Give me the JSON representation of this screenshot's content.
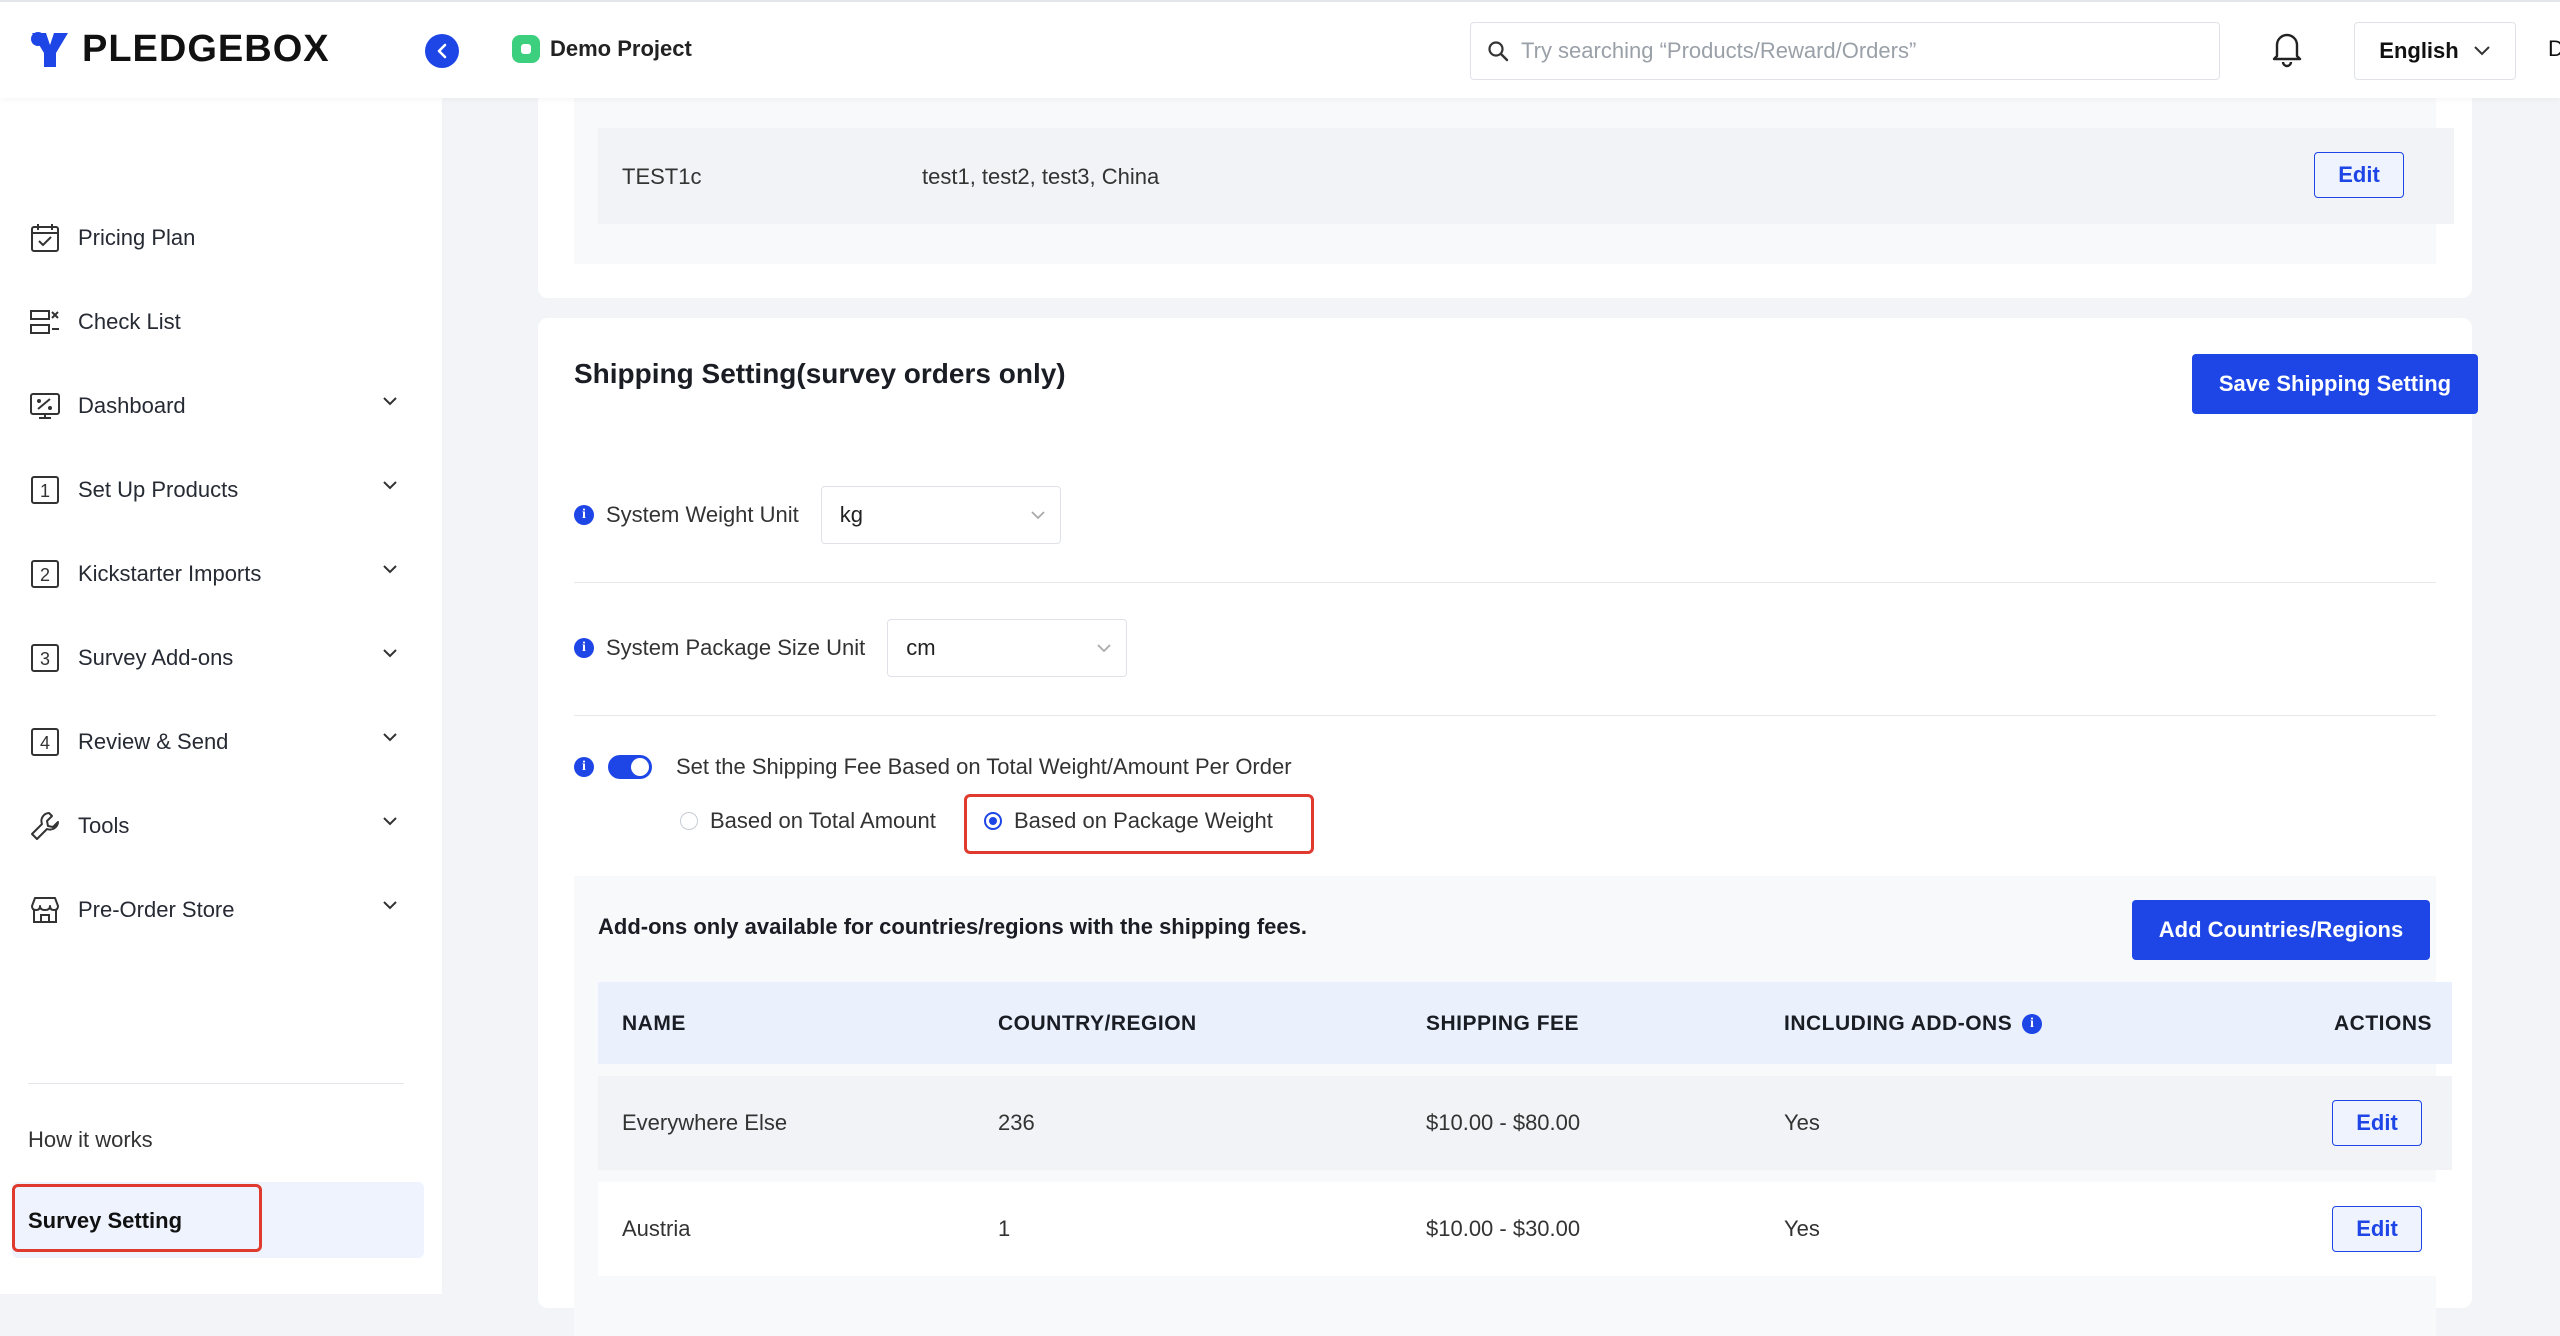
{
  "app": {
    "logo_text": "PLEDGEBOX",
    "project_name": "Demo Project"
  },
  "search": {
    "placeholder": "Try searching “Products/Reward/Orders”"
  },
  "language": {
    "selected": "English"
  },
  "edge_char": "D",
  "sidebar": {
    "items": [
      {
        "label": "Pricing Plan",
        "icon": "calendar-check-icon"
      },
      {
        "label": "Check List",
        "icon": "checklist-icon"
      },
      {
        "label": "Dashboard",
        "icon": "dashboard-icon"
      },
      {
        "label": "Set Up Products",
        "icon": "step-1-icon",
        "step": "1"
      },
      {
        "label": "Kickstarter Imports",
        "icon": "step-2-icon",
        "step": "2"
      },
      {
        "label": "Survey Add-ons",
        "icon": "step-3-icon",
        "step": "3"
      },
      {
        "label": "Review & Send",
        "icon": "step-4-icon",
        "step": "4"
      },
      {
        "label": "Tools",
        "icon": "wrench-icon"
      },
      {
        "label": "Pre-Order Store",
        "icon": "store-icon"
      }
    ],
    "how_it_works": "How it works",
    "survey_setting": "Survey Setting"
  },
  "zone_card": {
    "row": {
      "name": "TEST1c",
      "countries": "test1, test2, test3, China",
      "edit": "Edit"
    }
  },
  "shipping": {
    "title": "Shipping Setting(survey orders only)",
    "save_label": "Save Shipping Setting",
    "weight_unit_label": "System Weight Unit",
    "weight_unit_value": "kg",
    "size_unit_label": "System Package Size Unit",
    "size_unit_value": "cm",
    "fee_toggle_label": "Set the Shipping Fee Based on Total Weight/Amount Per Order",
    "radio_amount": "Based on Total Amount",
    "radio_weight": "Based on Package Weight",
    "note": "Add-ons only available for countries/regions with the shipping fees.",
    "add_label": "Add Countries/Regions",
    "columns": [
      "NAME",
      "COUNTRY/REGION",
      "SHIPPING FEE",
      "INCLUDING ADD-ONS",
      "ACTIONS"
    ],
    "rows": [
      {
        "name": "Everywhere Else",
        "count": "236",
        "fee": "$10.00 - $80.00",
        "addons": "Yes",
        "action": "Edit"
      },
      {
        "name": "Austria",
        "count": "1",
        "fee": "$10.00 - $30.00",
        "addons": "Yes",
        "action": "Edit"
      }
    ]
  },
  "colors": {
    "primary": "#1e46e6",
    "highlight": "#e0392d",
    "success": "#3ccf7e"
  }
}
